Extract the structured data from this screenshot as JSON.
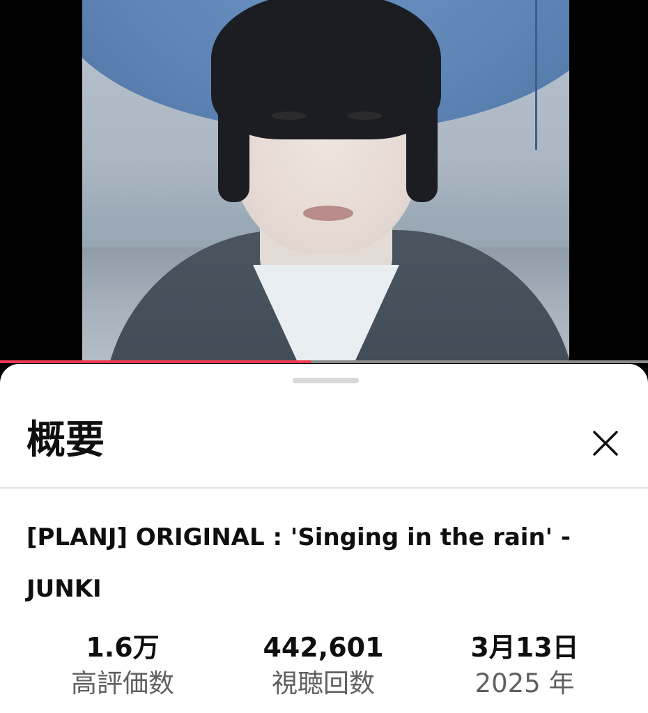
{
  "player": {
    "progress_fraction": 0.48,
    "progress_color": "#f23a52",
    "track_color": "#8a8a8a"
  },
  "sheet": {
    "title": "概要",
    "close_icon": "close-icon"
  },
  "video": {
    "title": "[PLANJ] ORIGINAL : 'Singing in the rain' - JUNKI"
  },
  "stats": [
    {
      "value": "1.6万",
      "label": "高評価数"
    },
    {
      "value": "442,601",
      "label": "視聴回数"
    },
    {
      "value": "3月13日",
      "label": "2025 年"
    }
  ]
}
